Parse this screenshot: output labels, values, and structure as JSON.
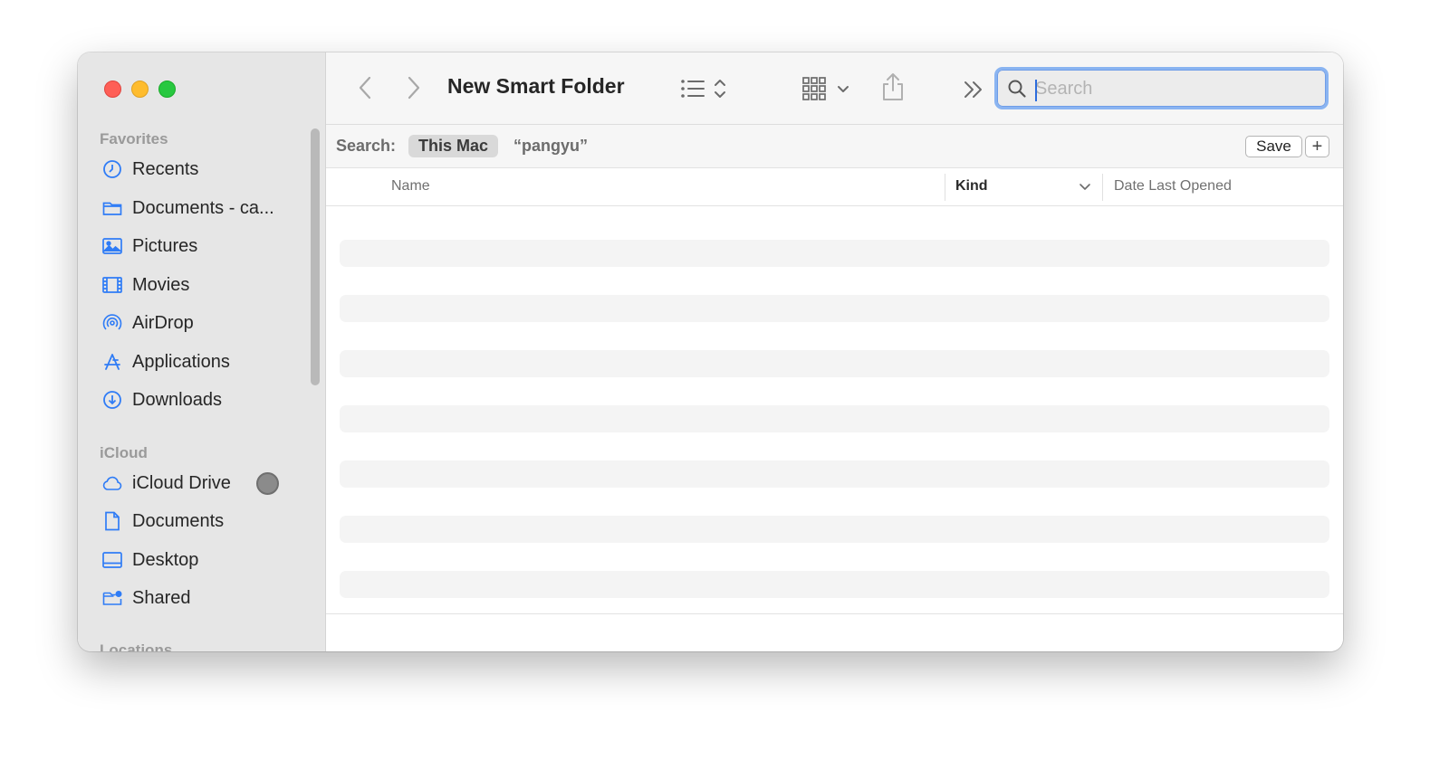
{
  "window": {
    "title": "New Smart Folder"
  },
  "sidebar": {
    "sections": {
      "favorites": "Favorites",
      "icloud": "iCloud",
      "locations": "Locations"
    },
    "favorites": [
      {
        "label": "Recents",
        "icon": "clock-icon"
      },
      {
        "label": "Documents - ca...",
        "icon": "folder-icon"
      },
      {
        "label": "Pictures",
        "icon": "photo-icon"
      },
      {
        "label": "Movies",
        "icon": "film-icon"
      },
      {
        "label": "AirDrop",
        "icon": "airdrop-icon"
      },
      {
        "label": "Applications",
        "icon": "applications-icon"
      },
      {
        "label": "Downloads",
        "icon": "download-icon"
      }
    ],
    "icloud": [
      {
        "label": "iCloud Drive",
        "icon": "cloud-icon"
      },
      {
        "label": "Documents",
        "icon": "document-icon"
      },
      {
        "label": "Desktop",
        "icon": "desktop-icon"
      },
      {
        "label": "Shared",
        "icon": "shared-folder-icon"
      }
    ]
  },
  "toolbar": {
    "search_placeholder": "Search"
  },
  "scope": {
    "label": "Search:",
    "selected": "This Mac",
    "term": "“pangyu”",
    "save_label": "Save",
    "add_label": "+"
  },
  "columns": {
    "name": "Name",
    "kind": "Kind",
    "date": "Date Last Opened"
  },
  "colors": {
    "accent": "#2c6cdc",
    "sidebar_icon": "#2f7cf6",
    "close": "#fe5f57",
    "minimize": "#febc2e",
    "zoom": "#28c840"
  }
}
